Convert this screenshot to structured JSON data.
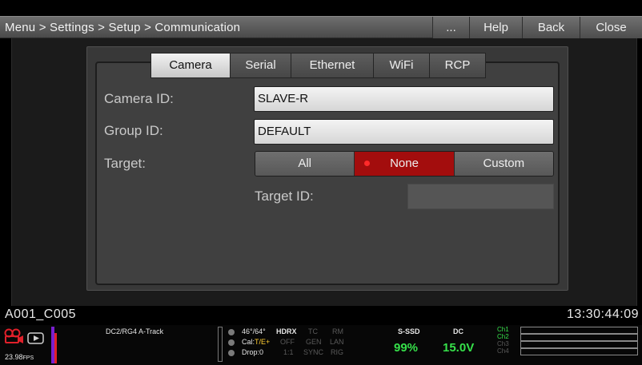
{
  "titlebar": {
    "breadcrumb": "Menu > Settings > Setup > Communication",
    "more_label": "...",
    "help_label": "Help",
    "back_label": "Back",
    "close_label": "Close"
  },
  "tabs": [
    {
      "label": "Camera",
      "active": true
    },
    {
      "label": "Serial",
      "active": false
    },
    {
      "label": "Ethernet",
      "active": false
    },
    {
      "label": "WiFi",
      "active": false
    },
    {
      "label": "RCP",
      "active": false
    }
  ],
  "form": {
    "camera_id_label": "Camera ID:",
    "camera_id_value": "SLAVE-R",
    "group_id_label": "Group ID:",
    "group_id_value": "DEFAULT",
    "target_label": "Target:",
    "target_options": [
      "All",
      "None",
      "Custom"
    ],
    "target_selected": "None",
    "target_id_label": "Target ID:",
    "target_id_value": ""
  },
  "clip": {
    "name": "A001_C005",
    "timecode": "13:30:44:09"
  },
  "status": {
    "fps": "23.98",
    "fps_unit": "FPS",
    "track": "DC2/RG4  A-Track",
    "temp": "46°/64°",
    "cal_prefix": "Cal:",
    "cal_value": "T/E+",
    "drop": "Drop:0",
    "hdrx": "HDRX",
    "hdrx_state": "OFF",
    "ratio": "1:1",
    "tc": "TC",
    "gen": "GEN",
    "sync": "SYNC",
    "rm": "RM",
    "lan": "LAN",
    "rig": "RIG",
    "media_label": "S-SSD",
    "media_value": "99%",
    "power_label": "DC",
    "power_value": "15.0V",
    "channels": [
      "Ch1",
      "Ch2",
      "Ch3",
      "Ch4"
    ]
  },
  "colors": {
    "selected_segment": "#a30d0d",
    "status_green": "#36e04a",
    "camera_icon_red": "#e0202a"
  }
}
